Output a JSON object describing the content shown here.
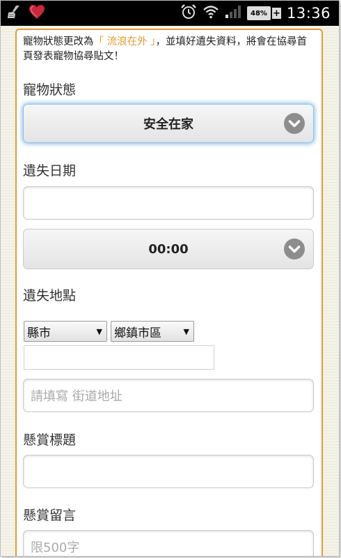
{
  "status_bar": {
    "time": "13:36",
    "battery_percent": "48%",
    "battery_plus": "+",
    "signal_bars_filled": 1,
    "signal_bars_total": 4
  },
  "intro": {
    "text_before": "寵物狀態更改為",
    "highlight": "「 流浪在外 」",
    "text_after": "，並填好遺失資料，將會在協尋首頁發表寵物協尋貼文！"
  },
  "form": {
    "pet_status": {
      "label": "寵物狀態",
      "value": "安全在家"
    },
    "lost_date": {
      "label": "遺失日期",
      "value": "",
      "time_value": "00:00"
    },
    "lost_location": {
      "label": "遺失地點",
      "county_select": "縣市",
      "town_select": "鄉鎮市區",
      "zip_value": "",
      "address_placeholder": "請填寫 街道地址"
    },
    "reward_title": {
      "label": "懸賞標題",
      "value": ""
    },
    "reward_message": {
      "label": "懸賞留言",
      "placeholder": "限500字"
    }
  },
  "colors": {
    "panel_border": "#e39a3b",
    "highlight_text": "#e59a2f",
    "focus_glow": "#7bb6e6"
  },
  "icons": [
    "broom-icon",
    "heart-icon",
    "alarm-clock-icon",
    "wifi-icon",
    "signal-icon",
    "battery-icon",
    "chevron-down-icon"
  ]
}
